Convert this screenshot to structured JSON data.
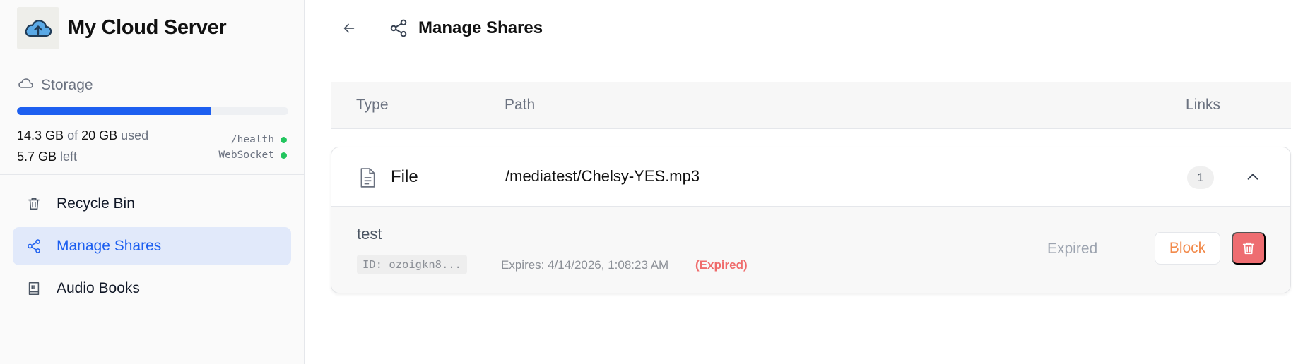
{
  "app": {
    "title": "My Cloud Server"
  },
  "storage": {
    "label": "Storage",
    "used_fraction": 0.715,
    "used_value": "14.3 GB",
    "of_text": "of",
    "total_value": "20 GB",
    "used_text": "used",
    "left_value": "5.7 GB",
    "left_text": "left",
    "health_label": "/health",
    "websocket_label": "WebSocket",
    "status_color": "#22c55e"
  },
  "nav": {
    "items": [
      {
        "label": "Recycle Bin",
        "icon": "trash-icon",
        "active": false
      },
      {
        "label": "Manage Shares",
        "icon": "share-icon",
        "active": true
      },
      {
        "label": "Audio Books",
        "icon": "book-icon",
        "active": false
      }
    ]
  },
  "header": {
    "title": "Manage Shares"
  },
  "table": {
    "columns": {
      "type": "Type",
      "path": "Path",
      "links": "Links"
    },
    "rows": [
      {
        "type": "File",
        "path": "/mediatest/Chelsy-YES.mp3",
        "link_count": "1",
        "links": [
          {
            "name": "test",
            "id": "ID: ozoigkn8...",
            "expires": "Expires: 4/14/2026, 1:08:23 AM",
            "expired_tag": "(Expired)",
            "status": "Expired",
            "block_label": "Block"
          }
        ]
      }
    ]
  },
  "colors": {
    "accent": "#1d5ff0",
    "danger": "#ee6d71",
    "warning": "#f28a4b",
    "active_bg": "#e1e9fa"
  }
}
